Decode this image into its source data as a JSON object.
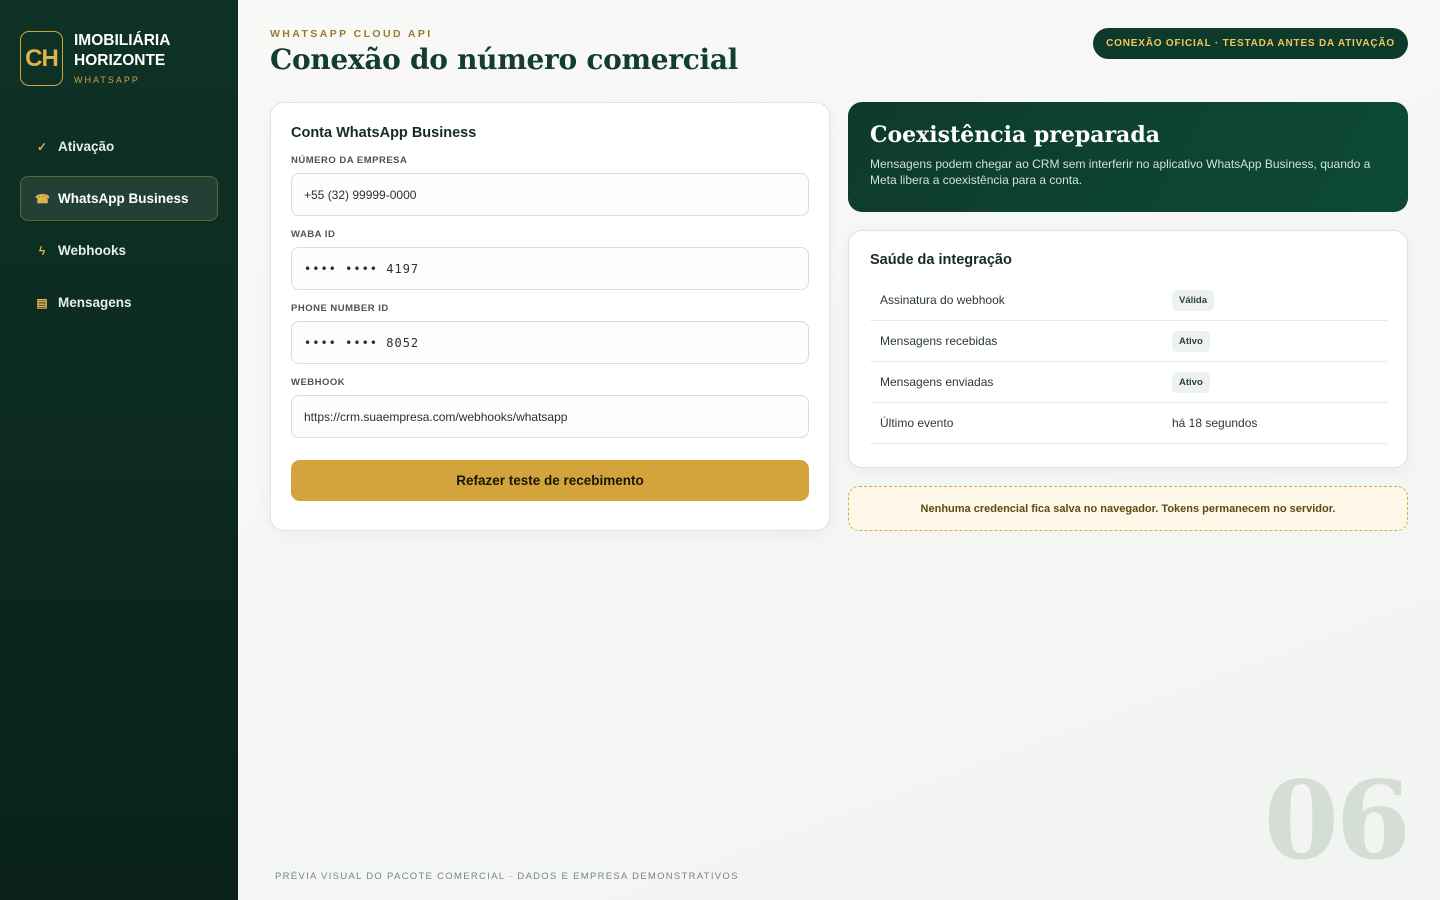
{
  "sidebar": {
    "logo": "CH",
    "brand_name": "IMOBILIÁRIA HORIZONTE",
    "brand_sub": "WHATSAPP",
    "items": [
      {
        "label": "Ativação",
        "icon": "check-icon",
        "glyph": "✓"
      },
      {
        "label": "WhatsApp Business",
        "icon": "phone-icon",
        "glyph": "☎"
      },
      {
        "label": "Webhooks",
        "icon": "lightning-icon",
        "glyph": "ϟ"
      },
      {
        "label": "Mensagens",
        "icon": "message-icon",
        "glyph": "▤"
      }
    ]
  },
  "header": {
    "eyebrow": "WHATSAPP CLOUD API",
    "title": "Conexão do número comercial",
    "badge": "CONEXÃO OFICIAL · TESTADA ANTES DA ATIVAÇÃO"
  },
  "form": {
    "title": "Conta WhatsApp Business",
    "fields": [
      {
        "label": "NÚMERO DA EMPRESA",
        "value": "+55 (32) 99999-0000"
      },
      {
        "label": "WABA ID",
        "value": "•••• •••• 4197"
      },
      {
        "label": "PHONE NUMBER ID",
        "value": "•••• •••• 8052"
      },
      {
        "label": "WEBHOOK",
        "value": "https://crm.suaempresa.com/webhooks/whatsapp"
      }
    ],
    "button": "Refazer teste de recebimento"
  },
  "coexistence": {
    "title": "Coexistência preparada",
    "text": "Mensagens podem chegar ao CRM sem interferir no aplicativo WhatsApp Business, quando a Meta libera a coexistência para a conta."
  },
  "health": {
    "title": "Saúde da integração",
    "rows": [
      {
        "key": "Assinatura do webhook",
        "value": "Válida"
      },
      {
        "key": "Mensagens recebidas",
        "value": "Ativo"
      },
      {
        "key": "Mensagens enviadas",
        "value": "Ativo"
      },
      {
        "key": "Último evento",
        "value": "há 18 segundos"
      }
    ]
  },
  "note": "Nenhuma credencial fica salva no navegador. Tokens permanecem no servidor.",
  "page_number": "06",
  "footer": "PRÉVIA VISUAL DO PACOTE COMERCIAL · DADOS E EMPRESA DEMONSTRATIVOS",
  "colors": {
    "sidebar": "#0e3226",
    "accent": "#d3a33c",
    "dark_green": "#0e3a2c"
  }
}
